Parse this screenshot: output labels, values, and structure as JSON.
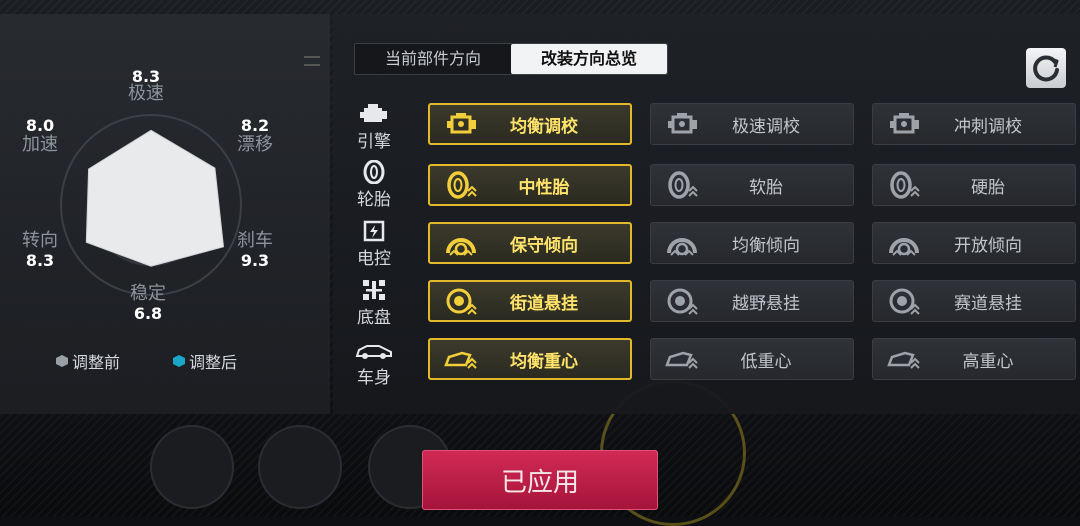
{
  "tabs": [
    "当前部件方向",
    "改装方向总览"
  ],
  "active_tab": 1,
  "stats": {
    "top": {
      "label": "极速",
      "value": "8.3"
    },
    "top_right": {
      "label": "漂移",
      "value": "8.2"
    },
    "bottom_right": {
      "label": "刹车",
      "value": "9.3"
    },
    "bottom": {
      "label": "稳定",
      "value": "6.8"
    },
    "bottom_left": {
      "label": "转向",
      "value": "8.3"
    },
    "top_left": {
      "label": "加速",
      "value": "8.0"
    }
  },
  "radar_values": [
    8.3,
    8.2,
    9.3,
    6.8,
    8.3,
    8.0
  ],
  "legend": {
    "before": "调整前",
    "after": "调整后"
  },
  "colors": {
    "accent": "#e2b92a",
    "selected_text": "#ffe36a",
    "apply": "#c21f4b",
    "before": "#9aa0a8",
    "after": "#1aa7c7"
  },
  "rows": [
    {
      "category": "引擎",
      "icon": "engine-icon",
      "options": [
        "均衡调校",
        "极速调校",
        "冲刺调校"
      ],
      "selected": 0
    },
    {
      "category": "轮胎",
      "icon": "tire-icon",
      "options": [
        "中性胎",
        "软胎",
        "硬胎"
      ],
      "selected": 0
    },
    {
      "category": "电控",
      "icon": "chip-icon",
      "options": [
        "保守倾向",
        "均衡倾向",
        "开放倾向"
      ],
      "selected": 0
    },
    {
      "category": "底盘",
      "icon": "chassis-icon",
      "options": [
        "街道悬挂",
        "越野悬挂",
        "赛道悬挂"
      ],
      "selected": 0
    },
    {
      "category": "车身",
      "icon": "car-body-icon",
      "options": [
        "均衡重心",
        "低重心",
        "高重心"
      ],
      "selected": 0
    }
  ],
  "apply_label": "已应用"
}
